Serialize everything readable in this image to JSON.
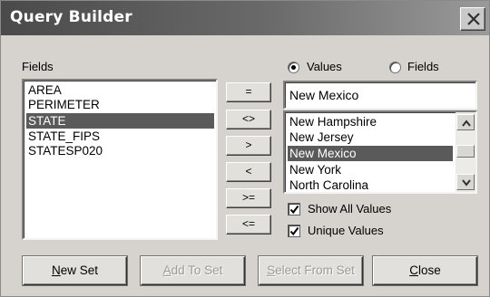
{
  "window": {
    "title": "Query Builder"
  },
  "fields_panel": {
    "label": "Fields",
    "items": [
      "AREA",
      "PERIMETER",
      "STATE",
      "STATE_FIPS",
      "STATESP020"
    ],
    "selected": "STATE"
  },
  "operators": [
    "=",
    "<>",
    ">",
    "<",
    ">=",
    "<="
  ],
  "source_toggle": {
    "values_label": "Values",
    "fields_label": "Fields",
    "selected": "Values"
  },
  "value_input": {
    "value": "New Mexico"
  },
  "values_list": {
    "items": [
      "New Hampshire",
      "New Jersey",
      "New Mexico",
      "New York",
      "North Carolina"
    ],
    "selected": "New Mexico"
  },
  "options": {
    "show_all_values": {
      "label": "Show All Values",
      "checked": true
    },
    "unique_values": {
      "label": "Unique Values",
      "checked": true
    }
  },
  "buttons": {
    "new_set": {
      "label_first": "N",
      "label_rest": "ew Set",
      "enabled": true
    },
    "add_to_set": {
      "label_first": "A",
      "label_rest": "dd To Set",
      "enabled": false
    },
    "select_from_set": {
      "label_first": "S",
      "label_rest": "elect From Set",
      "enabled": false
    },
    "close": {
      "label_first": "C",
      "label_rest": "lose",
      "enabled": true
    }
  },
  "colors": {
    "title_bar": "#4a4a4a",
    "selection": "#5a5a5a",
    "dialog_face": "#d6d3ce"
  },
  "icons": [
    "close-icon",
    "scroll-up-icon",
    "scroll-down-icon",
    "checkmark-icon"
  ]
}
